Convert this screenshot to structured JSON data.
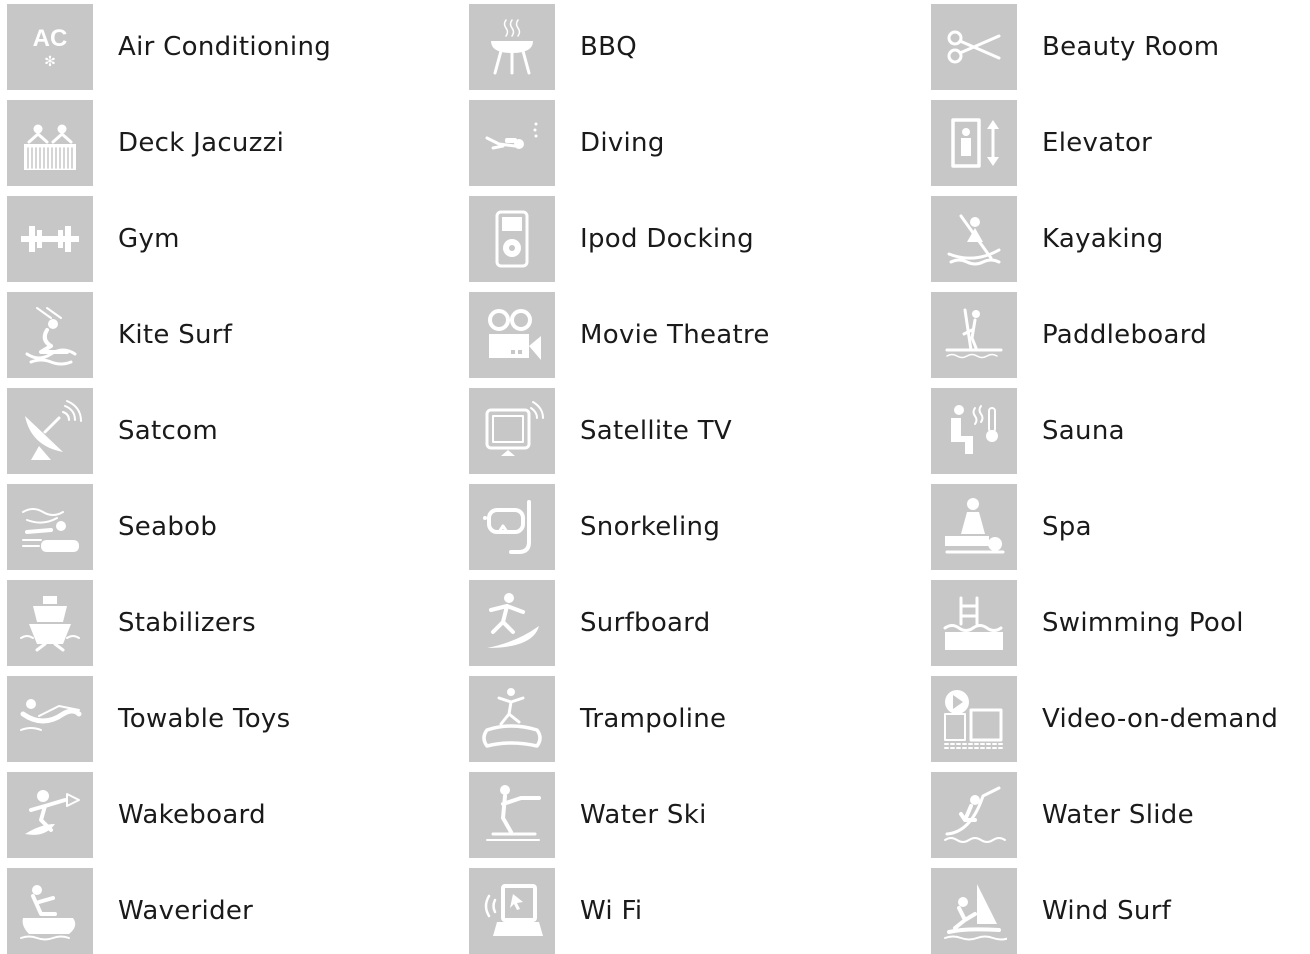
{
  "amenities": [
    {
      "label": "Air Conditioning",
      "icon": "air-conditioning-icon"
    },
    {
      "label": "BBQ",
      "icon": "bbq-icon"
    },
    {
      "label": "Beauty Room",
      "icon": "scissors-icon"
    },
    {
      "label": "Deck Jacuzzi",
      "icon": "jacuzzi-icon"
    },
    {
      "label": "Diving",
      "icon": "diver-icon"
    },
    {
      "label": "Elevator",
      "icon": "elevator-icon"
    },
    {
      "label": "Gym",
      "icon": "dumbbell-icon"
    },
    {
      "label": "Ipod Docking",
      "icon": "ipod-icon"
    },
    {
      "label": "Kayaking",
      "icon": "kayak-icon"
    },
    {
      "label": "Kite Surf",
      "icon": "kitesurf-icon"
    },
    {
      "label": "Movie Theatre",
      "icon": "movie-camera-icon"
    },
    {
      "label": "Paddleboard",
      "icon": "paddleboard-icon"
    },
    {
      "label": "Satcom",
      "icon": "satellite-dish-icon"
    },
    {
      "label": "Satellite TV",
      "icon": "tv-icon"
    },
    {
      "label": "Sauna",
      "icon": "sauna-icon"
    },
    {
      "label": "Seabob",
      "icon": "seabob-icon"
    },
    {
      "label": "Snorkeling",
      "icon": "snorkel-mask-icon"
    },
    {
      "label": "Spa",
      "icon": "massage-icon"
    },
    {
      "label": "Stabilizers",
      "icon": "ship-icon"
    },
    {
      "label": "Surfboard",
      "icon": "surfer-icon"
    },
    {
      "label": "Swimming Pool",
      "icon": "pool-ladder-icon"
    },
    {
      "label": "Towable Toys",
      "icon": "towable-icon"
    },
    {
      "label": "Trampoline",
      "icon": "trampoline-icon"
    },
    {
      "label": "Video-on-demand",
      "icon": "video-play-icon"
    },
    {
      "label": "Wakeboard",
      "icon": "wakeboard-icon"
    },
    {
      "label": "Water Ski",
      "icon": "water-ski-icon"
    },
    {
      "label": "Water Slide",
      "icon": "water-slide-icon"
    },
    {
      "label": "Waverider",
      "icon": "jetski-icon"
    },
    {
      "label": "Wi Fi",
      "icon": "wifi-laptop-icon"
    },
    {
      "label": "Wind Surf",
      "icon": "windsurf-icon"
    }
  ],
  "icon_labels": {
    "air_conditioning": "AC"
  },
  "colors": {
    "tile": "#c7c7c7",
    "icon": "#ffffff",
    "text": "#1a1a1a",
    "background": "#ffffff"
  }
}
